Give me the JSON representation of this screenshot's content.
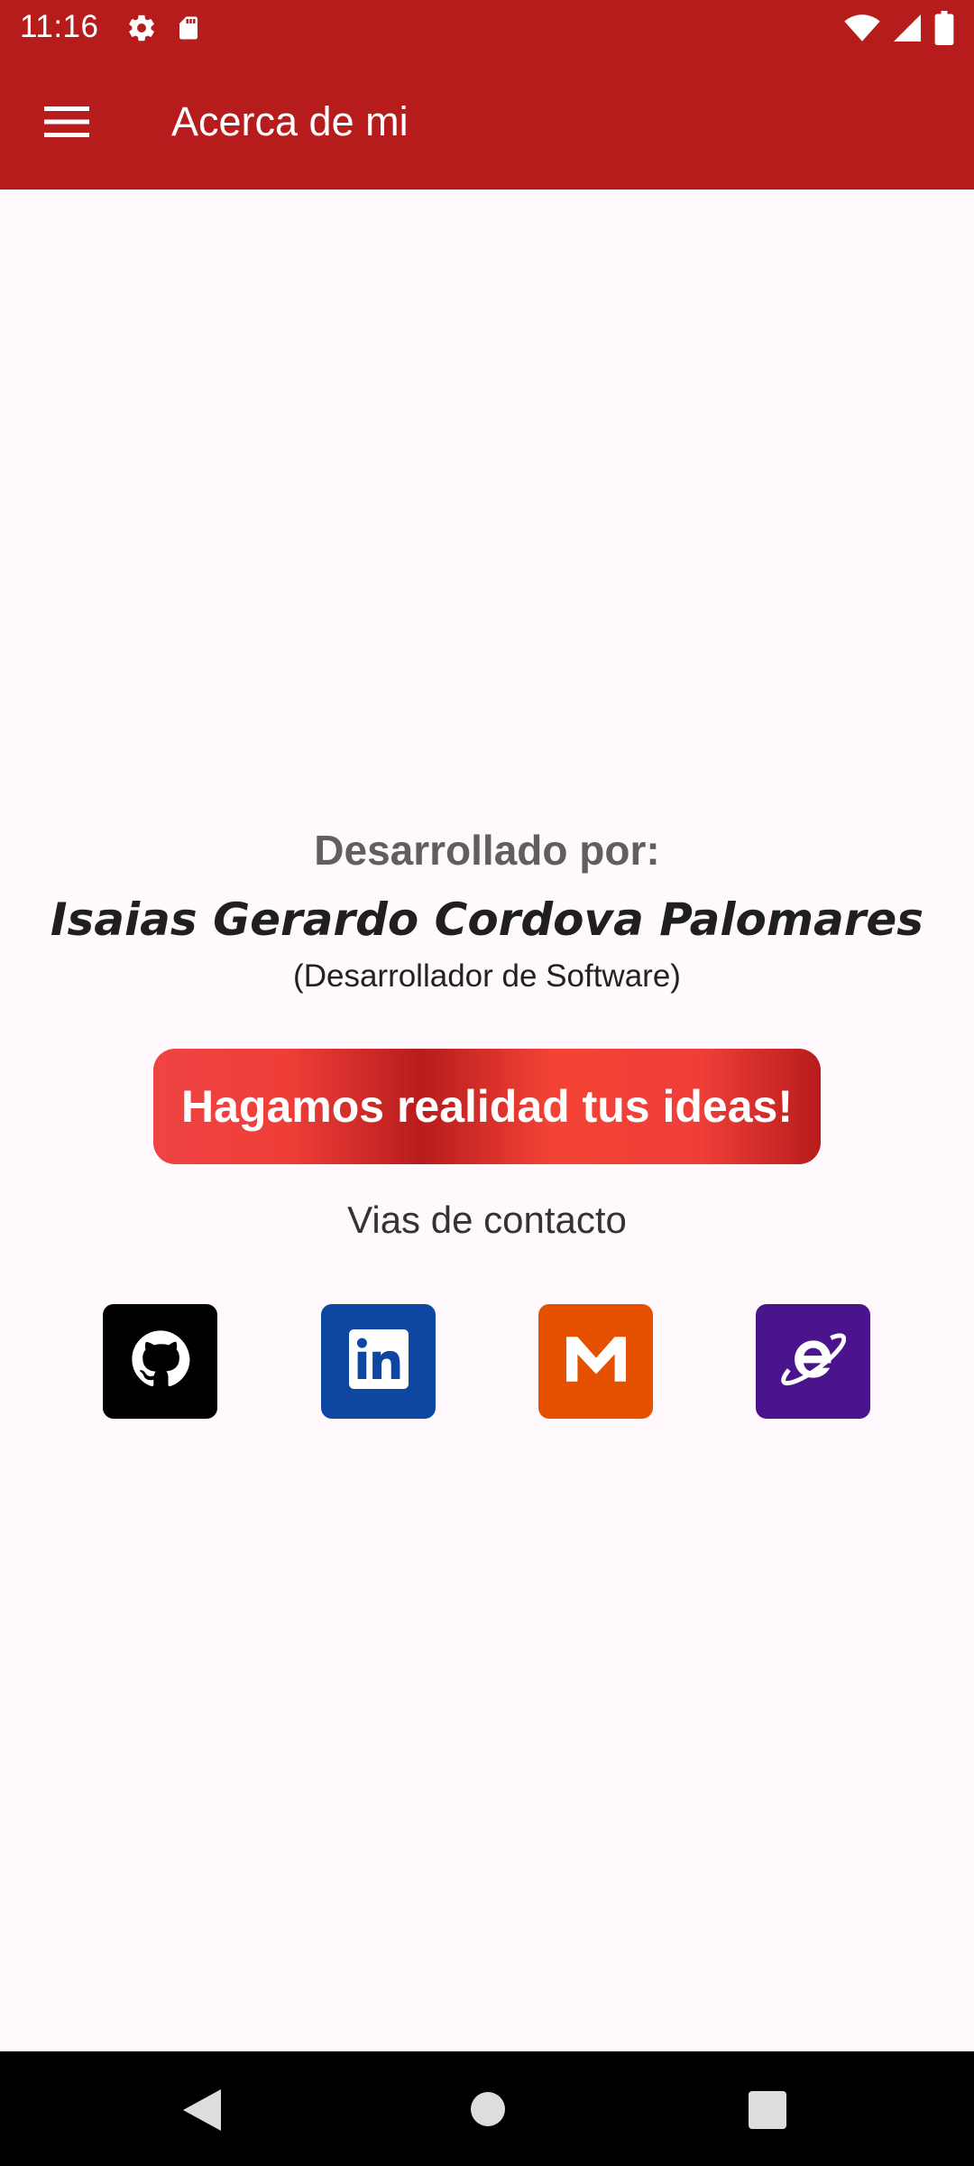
{
  "status_bar": {
    "time": "11:16",
    "left_icons": [
      "settings-icon",
      "sd-card-icon"
    ],
    "right_icons": [
      "wifi-icon",
      "cell-signal-icon",
      "battery-icon"
    ],
    "background": "#B71C1C"
  },
  "app_bar": {
    "title": "Acerca de mi",
    "menu_icon": "hamburger-menu-icon",
    "background": "#B71C1C"
  },
  "about": {
    "developed_by": "Desarrollado por:",
    "developer_name": "Isaias Gerardo Cordova Palomares",
    "developer_role": "(Desarrollador de Software)",
    "cta_label": "Hagamos realidad tus ideas!",
    "contact_title": "Vias de contacto",
    "contacts": [
      {
        "name": "github",
        "icon": "github-icon",
        "color": "#000000"
      },
      {
        "name": "linkedin",
        "icon": "linkedin-icon",
        "color": "#0D47A1"
      },
      {
        "name": "mega",
        "icon": "mega-icon",
        "color": "#E65100"
      },
      {
        "name": "web",
        "icon": "internet-explorer-icon",
        "color": "#4A148C"
      }
    ]
  },
  "nav_bar": {
    "icons": [
      "back-icon",
      "home-icon",
      "recents-icon"
    ]
  }
}
